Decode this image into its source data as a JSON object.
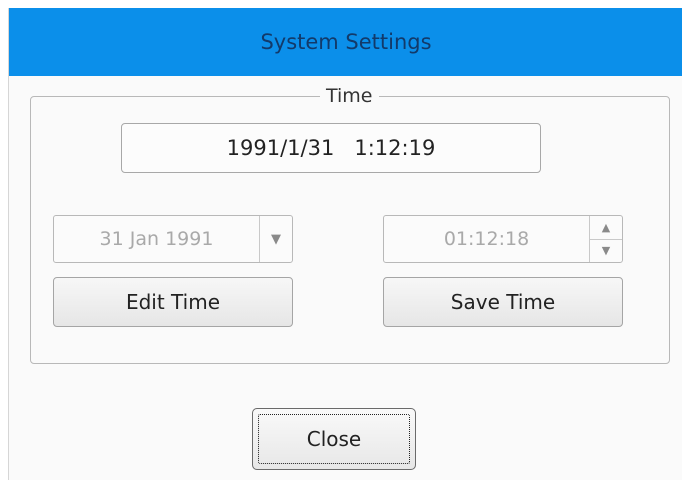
{
  "window": {
    "title": "System Settings"
  },
  "time_group": {
    "legend": "Time",
    "current_date": "1991/1/31",
    "current_time": "1:12:19",
    "date_picker": {
      "value": "31 Jan 1991",
      "dropdown_icon": "chevron-down-icon"
    },
    "time_spinner": {
      "value": "01:12:18",
      "up_icon": "arrow-up-icon",
      "down_icon": "arrow-down-icon"
    },
    "edit_label": "Edit Time",
    "save_label": "Save Time"
  },
  "footer": {
    "close_label": "Close"
  },
  "colors": {
    "titlebar": "#0b8fea",
    "title_text": "#123a6a",
    "disabled_text": "#a9a9a9"
  }
}
